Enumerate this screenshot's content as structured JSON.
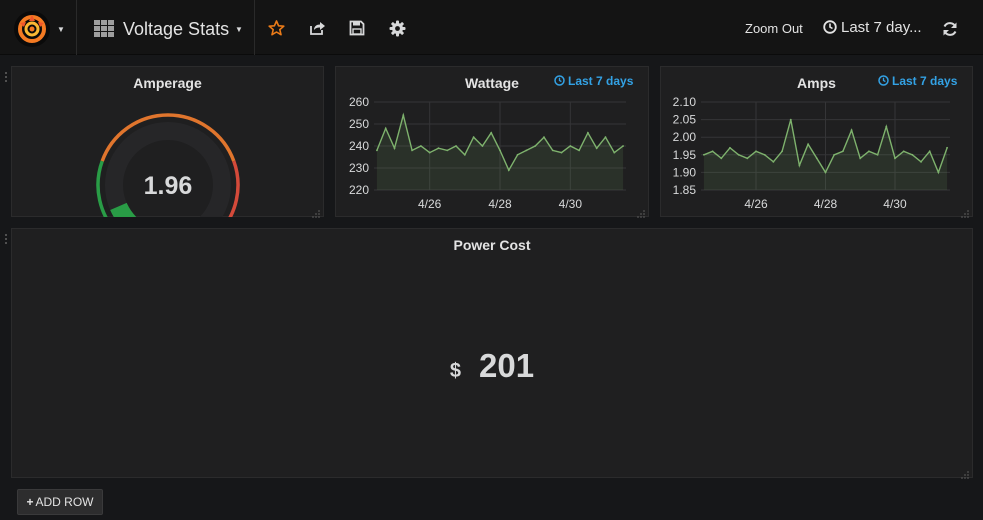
{
  "topbar": {
    "dashboard_title": "Voltage Stats",
    "zoom_out_label": "Zoom Out",
    "time_range_label": "Last 7 day...",
    "icons": [
      "grafana-logo-icon",
      "dashboard-grid-icon",
      "star-icon",
      "share-icon",
      "save-icon",
      "gear-icon",
      "clock-icon",
      "refresh-icon"
    ],
    "colors": {
      "star": "#eb7b18",
      "text": "#e3e3e3",
      "background": "#141414"
    }
  },
  "panels": {
    "amperage": {
      "title": "Amperage",
      "value": "1.96",
      "gauge_fraction": 0.08,
      "colors": {
        "green": "#299c46",
        "orange": "#e0752d",
        "red": "#d44a3a"
      }
    },
    "wattage": {
      "title": "Wattage",
      "time_override": "Last 7 days"
    },
    "amps": {
      "title": "Amps",
      "time_override": "Last 7 days"
    },
    "power_cost": {
      "title": "Power Cost",
      "prefix": "$",
      "value": "201"
    }
  },
  "add_row_label": "ADD ROW",
  "chart_data": [
    {
      "type": "line",
      "panel": "Wattage",
      "title": "Wattage",
      "ylim": [
        220,
        260
      ],
      "yticks": [
        "260",
        "250",
        "240",
        "230",
        "220"
      ],
      "xticks": [
        "4/26",
        "4/28",
        "4/30"
      ],
      "grid": true,
      "series": [
        {
          "color": "#7eb26d",
          "x": [
            "4/24 12:00",
            "4/24 18:00",
            "4/25 00:00",
            "4/25 06:00",
            "4/25 12:00",
            "4/25 18:00",
            "4/26 00:00",
            "4/26 06:00",
            "4/26 12:00",
            "4/26 18:00",
            "4/27 00:00",
            "4/27 06:00",
            "4/27 12:00",
            "4/27 18:00",
            "4/28 00:00",
            "4/28 06:00",
            "4/28 12:00",
            "4/28 18:00",
            "4/29 00:00",
            "4/29 06:00",
            "4/29 12:00",
            "4/29 18:00",
            "4/30 00:00",
            "4/30 06:00",
            "4/30 12:00",
            "4/30 18:00",
            "5/01 00:00",
            "5/01 06:00",
            "5/01 12:00"
          ],
          "values": [
            238,
            248,
            239,
            254,
            238,
            240,
            237,
            239,
            238,
            240,
            236,
            244,
            240,
            246,
            238,
            229,
            236,
            238,
            240,
            244,
            238,
            237,
            240,
            238,
            246,
            239,
            244,
            237,
            240
          ]
        }
      ]
    },
    {
      "type": "line",
      "panel": "Amps",
      "title": "Amps",
      "ylim": [
        1.85,
        2.1
      ],
      "yticks": [
        "2.10",
        "2.05",
        "2.00",
        "1.95",
        "1.90",
        "1.85"
      ],
      "xticks": [
        "4/26",
        "4/28",
        "4/30"
      ],
      "grid": true,
      "series": [
        {
          "color": "#7eb26d",
          "x": [
            "4/24 12:00",
            "4/24 18:00",
            "4/25 00:00",
            "4/25 06:00",
            "4/25 12:00",
            "4/25 18:00",
            "4/26 00:00",
            "4/26 06:00",
            "4/26 12:00",
            "4/26 18:00",
            "4/27 00:00",
            "4/27 06:00",
            "4/27 12:00",
            "4/27 18:00",
            "4/28 00:00",
            "4/28 06:00",
            "4/28 12:00",
            "4/28 18:00",
            "4/29 00:00",
            "4/29 06:00",
            "4/29 12:00",
            "4/29 18:00",
            "4/30 00:00",
            "4/30 06:00",
            "4/30 12:00",
            "4/30 18:00",
            "5/01 00:00",
            "5/01 06:00",
            "5/01 12:00"
          ],
          "values": [
            1.95,
            1.96,
            1.94,
            1.97,
            1.95,
            1.94,
            1.96,
            1.95,
            1.93,
            1.96,
            2.05,
            1.92,
            1.98,
            1.94,
            1.9,
            1.95,
            1.96,
            2.02,
            1.94,
            1.96,
            1.95,
            2.03,
            1.94,
            1.96,
            1.95,
            1.93,
            1.96,
            1.9,
            1.97
          ]
        }
      ]
    }
  ]
}
